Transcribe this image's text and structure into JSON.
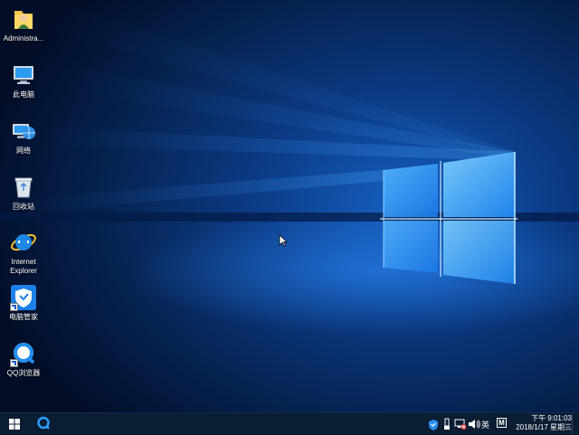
{
  "desktop": {
    "icons": [
      {
        "label": "Administra...",
        "icon": "user-folder-icon"
      },
      {
        "label": "此电脑",
        "icon": "computer-icon"
      },
      {
        "label": "网络",
        "icon": "network-icon"
      },
      {
        "label": "回收站",
        "icon": "recycle-bin-icon"
      },
      {
        "label": "Internet Explorer",
        "icon": "internet-explorer-icon"
      },
      {
        "label": "电脑管家",
        "icon": "pc-manager-icon"
      },
      {
        "label": "QQ浏览器",
        "icon": "qq-browser-icon"
      }
    ]
  },
  "taskbar": {
    "start_icon": "windows-logo-icon",
    "pinned": [
      {
        "icon": "qq-browser-icon"
      }
    ],
    "tray": {
      "ime_label": "英",
      "ime_mode": "M"
    },
    "clock": {
      "time": "下午 9:01:03",
      "date": "2018/1/17 星期三"
    }
  },
  "colors": {
    "taskbar_bg": "#0b1d33",
    "accent": "#1a8fff",
    "wallpaper_dark": "#031433"
  }
}
